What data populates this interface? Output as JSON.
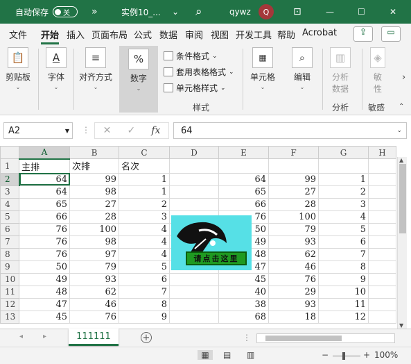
{
  "titlebar": {
    "autosave_label": "自动保存",
    "toggle_state": "关",
    "more": "»",
    "file_name": "实例10_...",
    "file_dropdown": "⌄",
    "search_icon": "⌕",
    "user_name": "qywz",
    "avatar_initial": "Q",
    "ribbon_display_icon": "⊡",
    "minimize": "—",
    "maximize": "☐",
    "close": "✕"
  },
  "menu": {
    "tabs": [
      "文件",
      "开始",
      "插入",
      "页面布局",
      "公式",
      "数据",
      "审阅",
      "视图",
      "开发工具",
      "帮助",
      "Acrobat"
    ],
    "share_icon": "⇪",
    "comment_icon": "▭"
  },
  "ribbon": {
    "clipboard": "剪贴板",
    "font": "字体",
    "alignment": "对齐方式",
    "number": "数字",
    "cond_format": "条件格式",
    "table_format": "套用表格格式",
    "cell_style": "单元格样式",
    "styles_group": "样式",
    "cells": "单元格",
    "editing": "编辑",
    "analyze": "分析\n数据",
    "analyze_top": "分析",
    "analyze_bottom": "数据",
    "analysis_group": "分析",
    "sensitivity_top": "敏",
    "sensitivity_bottom": "性",
    "sensitivity_group": "敏感",
    "more_arrow": "›",
    "collapse_arrow": "⌃",
    "dropdown": "⌄",
    "clipboard_icon": "📋",
    "font_icon": "A",
    "align_icon": "≡",
    "number_icon": "%"
  },
  "formula_bar": {
    "name_box": "A2",
    "cancel": "✕",
    "enter": "✓",
    "fx": "fx",
    "value": "64",
    "options": "⋮"
  },
  "sheet": {
    "columns": [
      "A",
      "B",
      "C",
      "D",
      "E",
      "F",
      "G",
      "H"
    ],
    "rows": [
      {
        "n": "1",
        "cells": [
          "主排",
          "次排",
          "名次",
          "",
          "",
          "",
          "",
          ""
        ]
      },
      {
        "n": "2",
        "cells": [
          "64",
          "99",
          "1",
          "",
          "64",
          "99",
          "1",
          ""
        ]
      },
      {
        "n": "3",
        "cells": [
          "64",
          "98",
          "1",
          "",
          "65",
          "27",
          "2",
          ""
        ]
      },
      {
        "n": "4",
        "cells": [
          "65",
          "27",
          "2",
          "",
          "66",
          "28",
          "3",
          ""
        ]
      },
      {
        "n": "5",
        "cells": [
          "66",
          "28",
          "3",
          "",
          "76",
          "100",
          "4",
          ""
        ]
      },
      {
        "n": "6",
        "cells": [
          "76",
          "100",
          "4",
          "",
          "50",
          "79",
          "5",
          ""
        ]
      },
      {
        "n": "7",
        "cells": [
          "76",
          "98",
          "4",
          "",
          "49",
          "93",
          "6",
          ""
        ]
      },
      {
        "n": "8",
        "cells": [
          "76",
          "97",
          "4",
          "",
          "48",
          "62",
          "7",
          ""
        ]
      },
      {
        "n": "9",
        "cells": [
          "50",
          "79",
          "5",
          "",
          "47",
          "46",
          "8",
          ""
        ]
      },
      {
        "n": "10",
        "cells": [
          "49",
          "93",
          "6",
          "",
          "45",
          "76",
          "9",
          ""
        ]
      },
      {
        "n": "11",
        "cells": [
          "48",
          "62",
          "7",
          "",
          "40",
          "29",
          "10",
          ""
        ]
      },
      {
        "n": "12",
        "cells": [
          "47",
          "46",
          "8",
          "",
          "38",
          "93",
          "11",
          ""
        ]
      },
      {
        "n": "13",
        "cells": [
          "45",
          "76",
          "9",
          "",
          "68",
          "18",
          "12",
          ""
        ]
      }
    ],
    "picture_button": "请点击这里"
  },
  "sheet_tabs": {
    "prev": "◂",
    "next": "▸",
    "active_tab": "111111",
    "add": "+",
    "more": "⋮"
  },
  "status": {
    "normal_view_icon": "▦",
    "page_layout_icon": "▤",
    "page_break_icon": "▥",
    "zoom_out": "−",
    "zoom_in": "+",
    "zoom": "100%"
  }
}
